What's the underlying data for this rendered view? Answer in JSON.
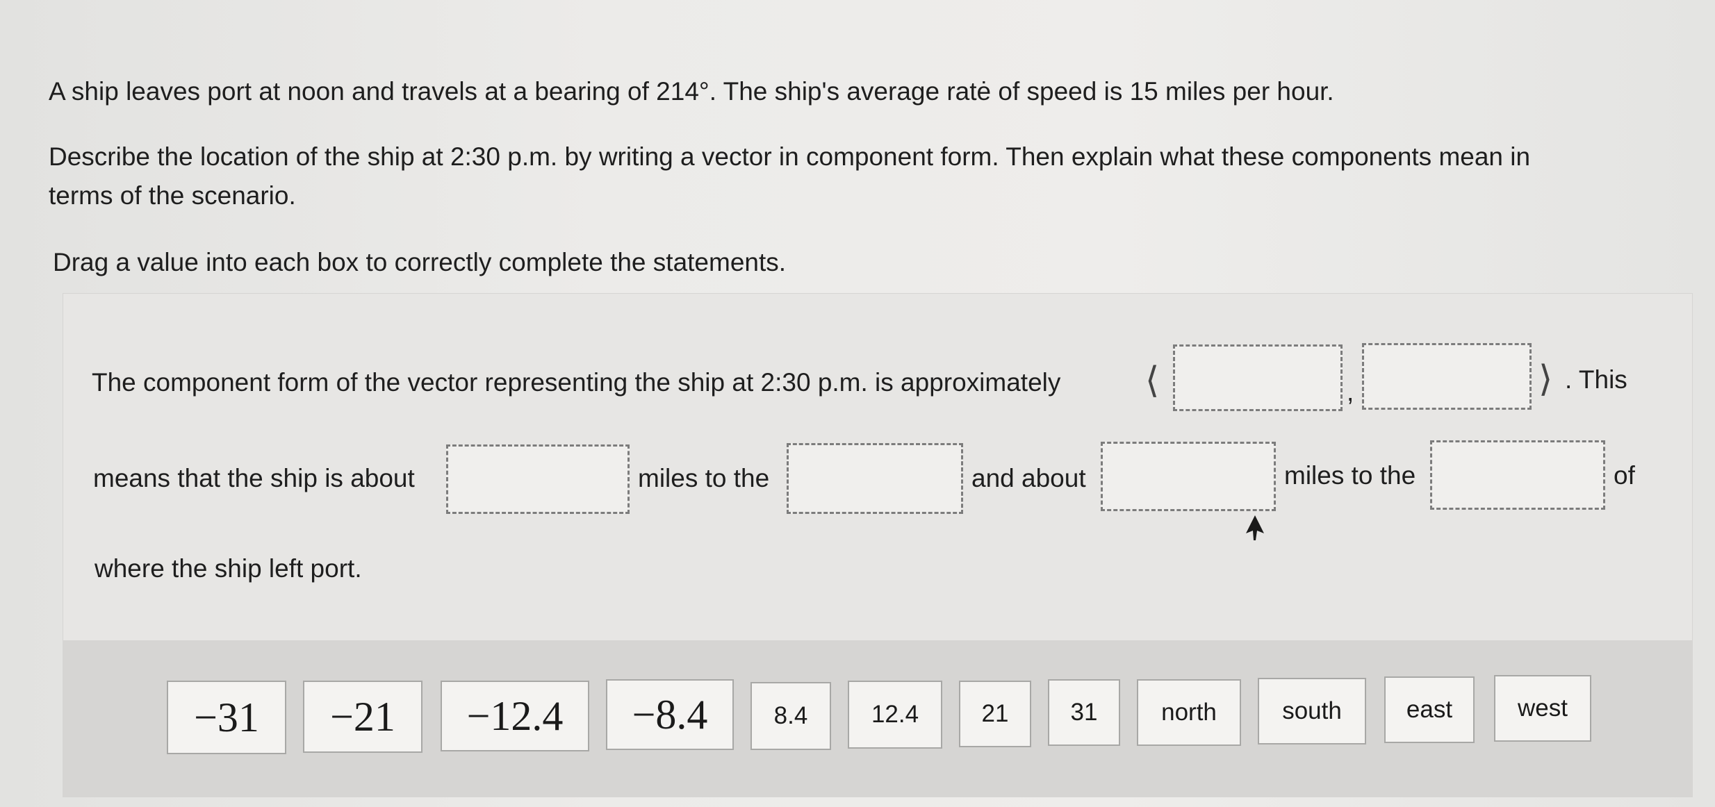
{
  "question": {
    "line1": "A ship leaves port at noon and travels at a bearing of 214°. The ship's average ratė of speed is 15 miles per hour.",
    "line2": "Describe the location of the ship at 2:30 p.m. by writing a vector in component form. Then explain what these components mean in",
    "line3": "terms of the scenario.",
    "instruction": "Drag a value into each box to correctly complete the statements."
  },
  "statement": {
    "part1": "The component form of the vector representing the ship at 2:30 p.m. is approximately",
    "open_bracket": "⟨",
    "comma": ",",
    "close_bracket": "⟩",
    "part2": ". This",
    "part3": "means that the ship is about",
    "part4": "miles to the",
    "part5": "and about",
    "part6": "miles to the",
    "part7": "of",
    "part8": "where the ship left port."
  },
  "drop_zones": {
    "x_component": "",
    "y_component": "",
    "distance_1": "",
    "direction_1": "",
    "distance_2": "",
    "direction_2": ""
  },
  "answer_tiles": [
    {
      "label": "−31",
      "style": "math"
    },
    {
      "label": "−21",
      "style": "math"
    },
    {
      "label": "−12.4",
      "style": "math"
    },
    {
      "label": "−8.4",
      "style": "math"
    },
    {
      "label": "8.4",
      "style": "plain"
    },
    {
      "label": "12.4",
      "style": "plain"
    },
    {
      "label": "21",
      "style": "plain"
    },
    {
      "label": "31",
      "style": "plain"
    },
    {
      "label": "north",
      "style": "plain"
    },
    {
      "label": "south",
      "style": "plain"
    },
    {
      "label": "east",
      "style": "plain"
    },
    {
      "label": "west",
      "style": "plain"
    }
  ]
}
